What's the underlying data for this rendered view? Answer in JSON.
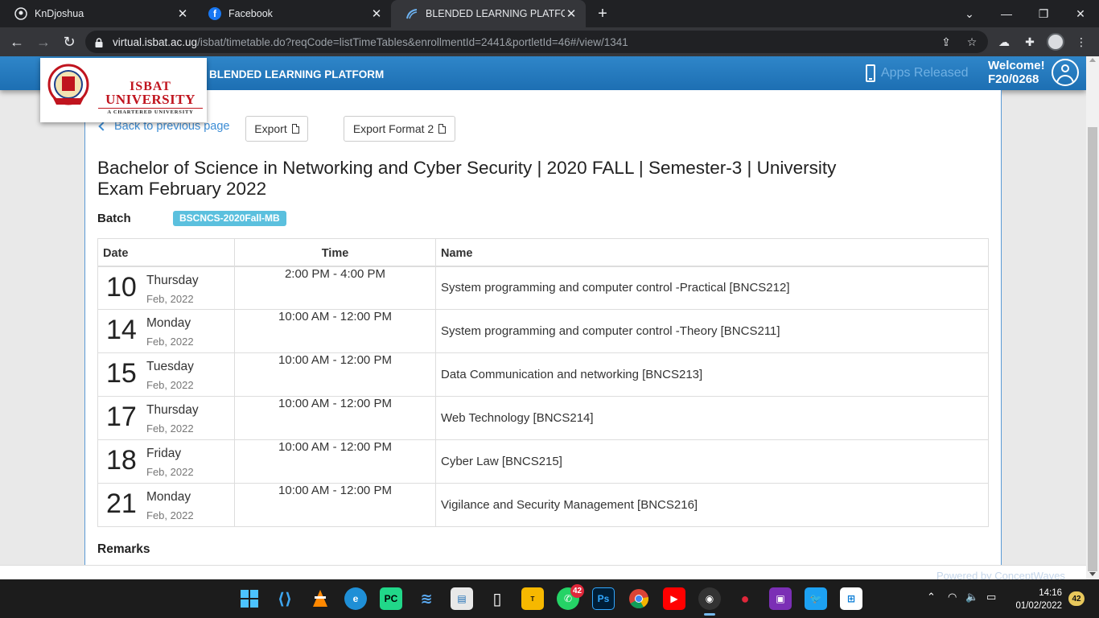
{
  "browser": {
    "tabs": [
      {
        "title": "KnDjoshua"
      },
      {
        "title": "Facebook"
      },
      {
        "title": "BLENDED LEARNING PLATFORM"
      }
    ],
    "url_host": "virtual.isbat.ac.ug",
    "url_path": "/isbat/timetable.do?reqCode=listTimeTables&enrollmentId=2441&portletId=46#/view/1341"
  },
  "header": {
    "logo": {
      "line1": "ISBAT",
      "line2": "UNIVERSITY",
      "line3": "A CHARTERED UNIVERSITY"
    },
    "platform_title": "BLENDED LEARNING PLATFORM",
    "apps_released": "Apps Released",
    "welcome": "Welcome!",
    "user_id": "F20/0268"
  },
  "toolbar": {
    "back_label": "Back to previous page",
    "export_label": "Export",
    "export2_label": "Export Format 2"
  },
  "exam": {
    "title": "Bachelor of Science in Networking and Cyber Security | 2020 FALL | Semester-3 | University Exam February 2022",
    "batch_label": "Batch",
    "batch_value": "BSCNCS-2020Fall-MB"
  },
  "table": {
    "headers": {
      "date": "Date",
      "time": "Time",
      "name": "Name"
    },
    "rows": [
      {
        "day": "10",
        "weekday": "Thursday",
        "month": "Feb, 2022",
        "time": "2:00 PM - 4:00 PM",
        "name": "System programming and computer control -Practical [BNCS212]"
      },
      {
        "day": "14",
        "weekday": "Monday",
        "month": "Feb, 2022",
        "time": "10:00 AM - 12:00 PM",
        "name": "System programming and computer control -Theory [BNCS211]"
      },
      {
        "day": "15",
        "weekday": "Tuesday",
        "month": "Feb, 2022",
        "time": "10:00 AM - 12:00 PM",
        "name": "Data Communication and networking [BNCS213]"
      },
      {
        "day": "17",
        "weekday": "Thursday",
        "month": "Feb, 2022",
        "time": "10:00 AM - 12:00 PM",
        "name": "Web Technology [BNCS214]"
      },
      {
        "day": "18",
        "weekday": "Friday",
        "month": "Feb, 2022",
        "time": "10:00 AM - 12:00 PM",
        "name": "Cyber Law [BNCS215]"
      },
      {
        "day": "21",
        "weekday": "Monday",
        "month": "Feb, 2022",
        "time": "10:00 AM - 12:00 PM",
        "name": "Vigilance and Security Management [BNCS216]"
      }
    ]
  },
  "remarks_label": "Remarks",
  "footer": {
    "powered_by": "Powered by ConceptWaves"
  },
  "taskbar": {
    "whatsapp_badge": "42",
    "notification_count": "42",
    "time": "14:16",
    "date": "01/02/2022"
  },
  "colors": {
    "header_blue": "#1d6fb3",
    "link_blue": "#3c8dd5",
    "badge_cyan": "#5bc0de",
    "logo_red": "#c0141e"
  }
}
